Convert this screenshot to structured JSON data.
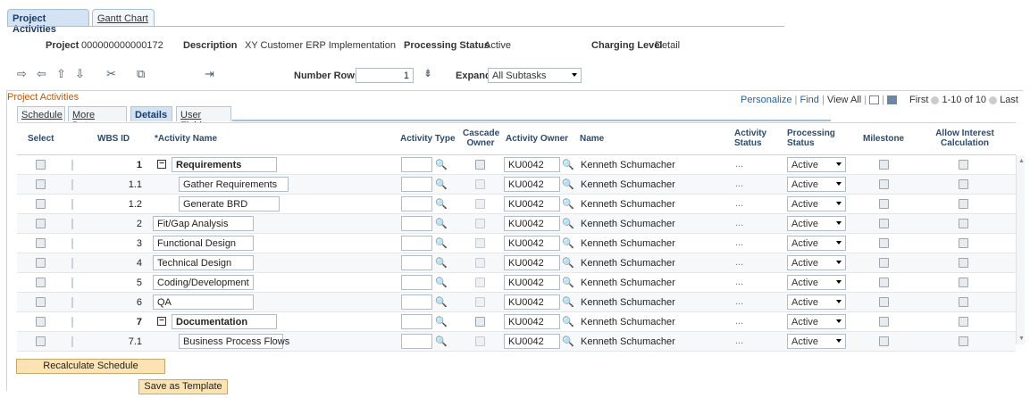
{
  "tabs": [
    "Project Activities",
    "Gantt Chart"
  ],
  "header": {
    "project_label": "Project",
    "project_value": "000000000000172",
    "description_label": "Description",
    "description_value": "XY Customer ERP Implementation",
    "status_label": "Processing Status",
    "status_value": "Active",
    "charging_label": "Charging Level",
    "charging_value": "Detail"
  },
  "toolbar": {
    "number_rows_label": "Number Rows",
    "number_rows_value": "1",
    "expand_label": "Expand",
    "expand_value": "All Subtasks"
  },
  "grid": {
    "title": "Project Activities",
    "personalize": "Personalize",
    "find": "Find",
    "view_all": "View All",
    "first": "First",
    "range": "1-10 of 10",
    "last": "Last",
    "subtabs": [
      "Schedule",
      "More Dates",
      "Details",
      "User Fields"
    ],
    "columns": {
      "select": "Select",
      "wbs": "WBS ID",
      "activity_name": "*Activity Name",
      "activity_type": "Activity Type",
      "cascade_1": "Cascade",
      "cascade_2": "Owner",
      "activity_owner": "Activity Owner",
      "name": "Name",
      "activity_status_1": "Activity",
      "activity_status_2": "Status",
      "processing_status_1": "Processing",
      "processing_status_2": "Status",
      "milestone": "Milestone",
      "allow_interest_1": "Allow Interest",
      "allow_interest_2": "Calculation"
    },
    "rows": [
      {
        "wbs": "1",
        "name": "Requirements",
        "summary": true,
        "owner": "KU0042",
        "owner_name": "Kenneth Schumacher",
        "activity_status": "...",
        "processing_status": "Active"
      },
      {
        "wbs": "1.1",
        "name": "Gather Requirements",
        "summary": false,
        "owner": "KU0042",
        "owner_name": "Kenneth Schumacher",
        "activity_status": "...",
        "processing_status": "Active"
      },
      {
        "wbs": "1.2",
        "name": "Generate BRD",
        "summary": false,
        "owner": "KU0042",
        "owner_name": "Kenneth Schumacher",
        "activity_status": "...",
        "processing_status": "Active"
      },
      {
        "wbs": "2",
        "name": "Fit/Gap Analysis",
        "summary": false,
        "owner": "KU0042",
        "owner_name": "Kenneth Schumacher",
        "activity_status": "...",
        "processing_status": "Active"
      },
      {
        "wbs": "3",
        "name": "Functional Design",
        "summary": false,
        "owner": "KU0042",
        "owner_name": "Kenneth Schumacher",
        "activity_status": "...",
        "processing_status": "Active"
      },
      {
        "wbs": "4",
        "name": "Technical Design",
        "summary": false,
        "owner": "KU0042",
        "owner_name": "Kenneth Schumacher",
        "activity_status": "...",
        "processing_status": "Active"
      },
      {
        "wbs": "5",
        "name": "Coding/Development",
        "summary": false,
        "owner": "KU0042",
        "owner_name": "Kenneth Schumacher",
        "activity_status": "...",
        "processing_status": "Active"
      },
      {
        "wbs": "6",
        "name": "QA",
        "summary": false,
        "owner": "KU0042",
        "owner_name": "Kenneth Schumacher",
        "activity_status": "...",
        "processing_status": "Active"
      },
      {
        "wbs": "7",
        "name": "Documentation",
        "summary": true,
        "owner": "KU0042",
        "owner_name": "Kenneth Schumacher",
        "activity_status": "...",
        "processing_status": "Active"
      },
      {
        "wbs": "7.1",
        "name": "Business Process Flows",
        "summary": false,
        "owner": "KU0042",
        "owner_name": "Kenneth Schumacher",
        "activity_status": "...",
        "processing_status": "Active"
      }
    ]
  },
  "buttons": {
    "recalculate": "Recalculate Schedule",
    "save_template": "Save as Template"
  }
}
